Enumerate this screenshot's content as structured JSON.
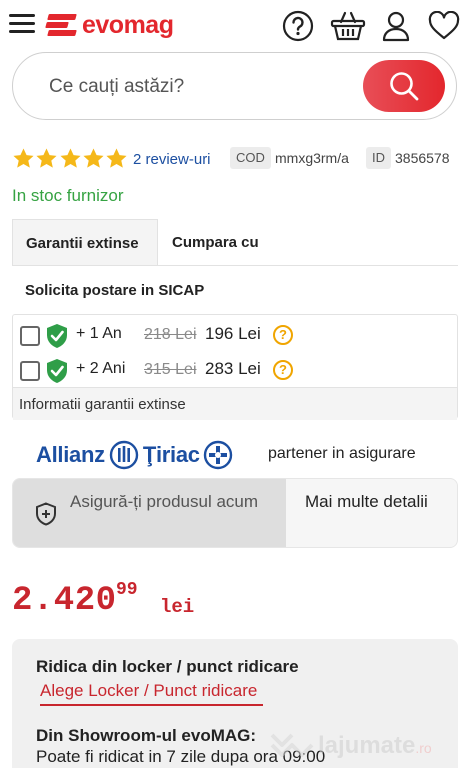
{
  "header": {
    "logo_text": "evomag",
    "brand_color": "#e3272d",
    "icons": [
      "menu-icon",
      "help-icon",
      "basket-icon",
      "user-icon",
      "heart-icon"
    ]
  },
  "search": {
    "placeholder": "Ce cauți astăzi?",
    "value": ""
  },
  "product": {
    "rating_stars": 5,
    "reviews_link": "2 review-uri",
    "code_label": "COD",
    "code_value": "mmxg3rm/a",
    "id_label": "ID",
    "id_value": "3856578",
    "stock_status": "In stoc furnizor"
  },
  "tabs": {
    "active": "Garantii extinse",
    "second": "Cumpara cu"
  },
  "sicap_text": "Solicita postare in SICAP",
  "warranty": {
    "options": [
      {
        "label": "+ 1 An",
        "old_price": "218 Lei",
        "new_price": "196 Lei",
        "help": "?"
      },
      {
        "label": "+ 2 Ani",
        "old_price": "315 Lei",
        "new_price": "283 Lei",
        "help": "?"
      }
    ],
    "info_text": "Informatii garantii extinse"
  },
  "insurance": {
    "partner_logo_text": "Allianz",
    "partner_logo_text2": "Ţiriac",
    "partner_text": "partener in asigurare",
    "ensure_button": "Asigură-ți produsul acum",
    "more_details": "Mai multe detalii"
  },
  "price": {
    "integer": "2.420",
    "decimals": "99",
    "currency": "lei",
    "color": "#c8262e"
  },
  "pickup": {
    "title": "Ridica din locker / punct ridicare",
    "link": "Alege Locker / Punct ridicare",
    "showroom_title": "Din Showroom-ul evoMAG:",
    "showroom_text": "Poate fi ridicat in 7 zile dupa ora 09:00"
  },
  "watermark": {
    "text": "lajumate",
    "suffix": ".ro"
  }
}
